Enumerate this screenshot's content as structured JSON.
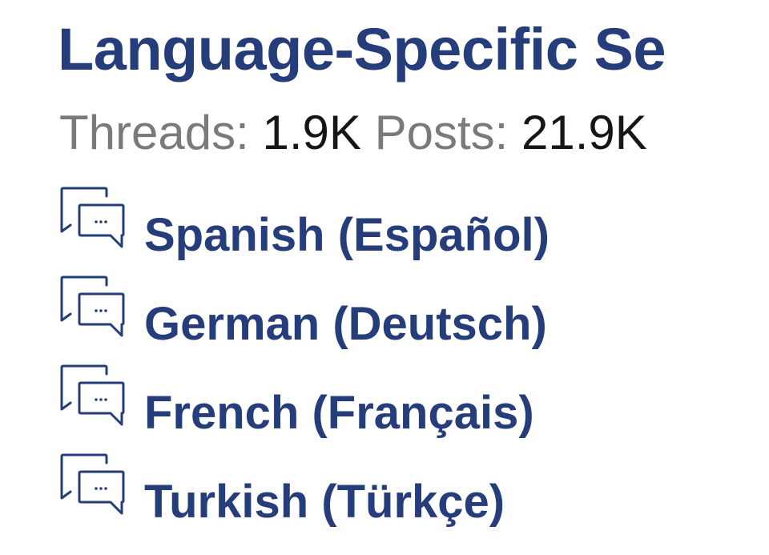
{
  "forum": {
    "title": "Language-Specific Se",
    "stats": {
      "threads_label": "Threads:",
      "threads_value": "1.9K",
      "posts_label": "Posts:",
      "posts_value": "21.9K"
    },
    "subforums": [
      {
        "label": "Spanish (Español)",
        "icon": "subforum-chat-icon"
      },
      {
        "label": "German (Deutsch)",
        "icon": "subforum-chat-icon"
      },
      {
        "label": "French (Français)",
        "icon": "subforum-chat-icon"
      },
      {
        "label": "Turkish (Türkçe)",
        "icon": "subforum-chat-icon"
      }
    ]
  },
  "colors": {
    "link": "#263d7b",
    "label_gray": "#7a7a7a",
    "value_text": "#161616",
    "background": "#ffffff"
  }
}
